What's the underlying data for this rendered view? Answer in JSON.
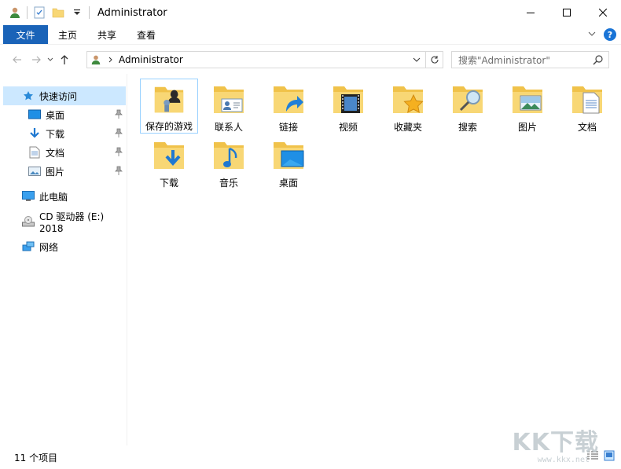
{
  "window": {
    "title": "Administrator",
    "controls": {
      "minimize": "—",
      "maximize": "☐",
      "close": "✕"
    }
  },
  "ribbon": {
    "file_tab": "文件",
    "tabs": [
      "主页",
      "共享",
      "查看"
    ],
    "help": "?"
  },
  "nav": {
    "address_path": "Administrator",
    "search_placeholder": "搜索\"Administrator\""
  },
  "sidebar": {
    "items": [
      {
        "label": "快速访问",
        "icon": "star-icon",
        "selected": true
      },
      {
        "label": "桌面",
        "icon": "desktop-icon",
        "pinned": true
      },
      {
        "label": "下载",
        "icon": "download-arrow-icon",
        "pinned": true
      },
      {
        "label": "文档",
        "icon": "document-icon",
        "pinned": true
      },
      {
        "label": "图片",
        "icon": "picture-icon",
        "pinned": true
      },
      {
        "label": "此电脑",
        "icon": "computer-icon"
      },
      {
        "label": "CD 驱动器 (E:) 2018",
        "icon": "cd-drive-icon"
      },
      {
        "label": "网络",
        "icon": "network-icon"
      }
    ]
  },
  "content": {
    "items": [
      {
        "label": "保存的游戏",
        "icon": "saved-games-folder-icon",
        "selected": true
      },
      {
        "label": "联系人",
        "icon": "contacts-folder-icon"
      },
      {
        "label": "链接",
        "icon": "links-folder-icon"
      },
      {
        "label": "视频",
        "icon": "videos-folder-icon"
      },
      {
        "label": "收藏夹",
        "icon": "favorites-folder-icon"
      },
      {
        "label": "搜索",
        "icon": "searches-folder-icon"
      },
      {
        "label": "图片",
        "icon": "pictures-folder-icon"
      },
      {
        "label": "文档",
        "icon": "documents-folder-icon"
      },
      {
        "label": "下载",
        "icon": "downloads-folder-icon"
      },
      {
        "label": "音乐",
        "icon": "music-folder-icon"
      },
      {
        "label": "桌面",
        "icon": "desktop-folder-icon"
      }
    ]
  },
  "status": {
    "item_count": "11 个项目"
  },
  "watermark": {
    "text": "KK下载",
    "url": "www.kkx.net"
  },
  "colors": {
    "file_tab_bg": "#1a63b8",
    "selection_bg": "#cce8ff",
    "folder_yellow": "#f8d775",
    "accent_blue": "#1a74d6"
  }
}
